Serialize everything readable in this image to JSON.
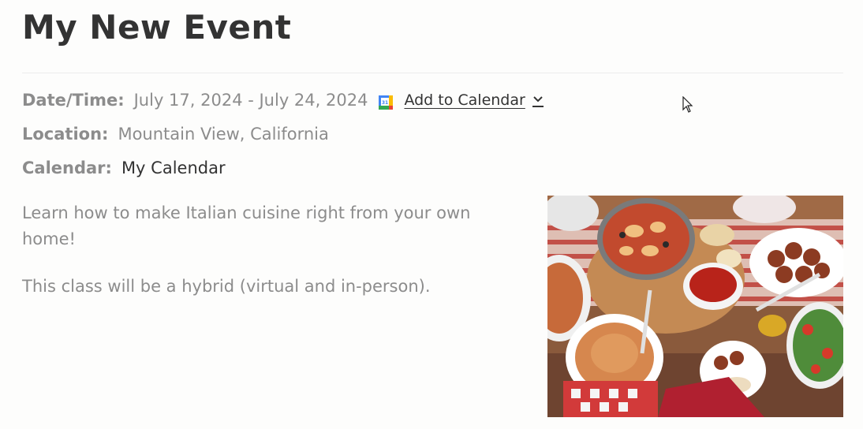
{
  "event": {
    "title": "My New Event"
  },
  "details": {
    "datetime_label": "Date/Time:",
    "datetime_value": "July 17, 2024 - July 24, 2024",
    "calendar_icon_text": "31",
    "add_to_calendar_label": "Add to Calendar",
    "location_label": "Location:",
    "location_value": "Mountain View, California",
    "calendar_label": "Calendar:",
    "calendar_value": "My Calendar"
  },
  "description": {
    "paragraph_1": "Learn how to make Italian cuisine right from your own home!",
    "paragraph_2": "This class will be a hybrid (virtual and in-person)."
  },
  "icons": {
    "google_calendar": "google-calendar-icon",
    "dropdown": "chevron-down-icon",
    "cursor": "mouse-cursor-icon"
  },
  "colors": {
    "title": "#333333",
    "muted_text": "#8c8c8c",
    "divider": "#ececec",
    "background": "#fdfdfc"
  }
}
